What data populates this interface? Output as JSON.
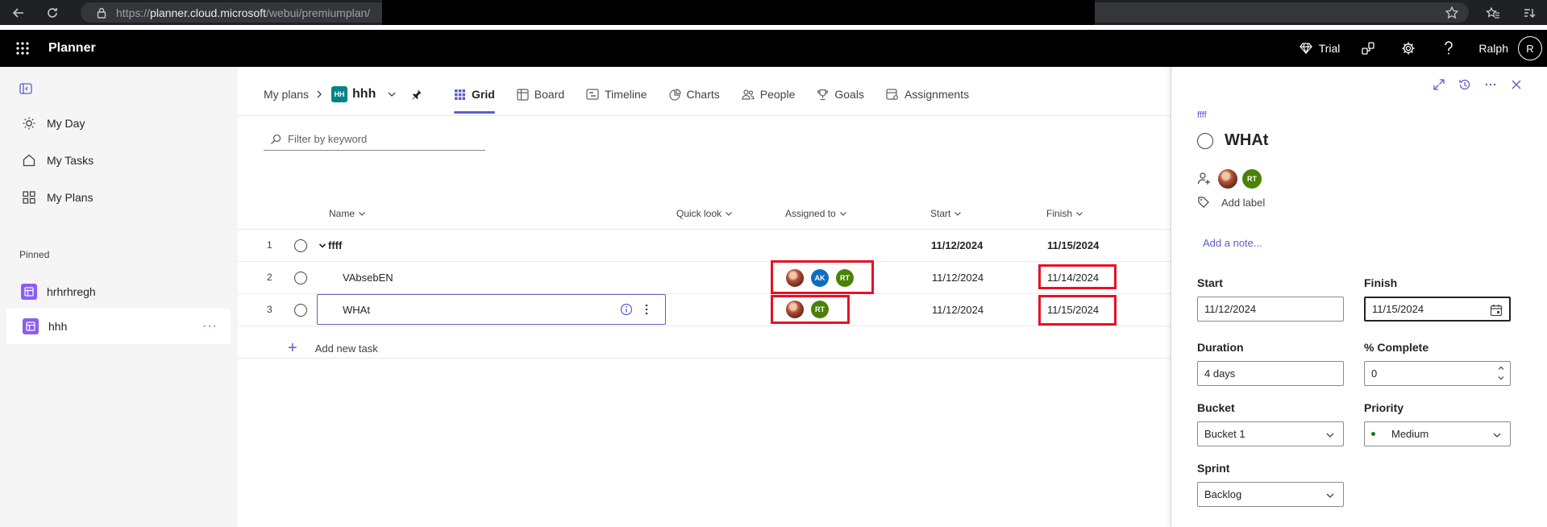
{
  "browser": {
    "url_prefix": "https://",
    "url_host": "planner.cloud.microsoft",
    "url_path": "/webui/premiumplan/"
  },
  "app": {
    "name": "Planner",
    "trial_label": "Trial",
    "user_name": "Ralph",
    "user_initial": "R"
  },
  "sidebar": {
    "items": [
      {
        "label": "My Day",
        "icon": "sun-icon"
      },
      {
        "label": "My Tasks",
        "icon": "home-icon"
      },
      {
        "label": "My Plans",
        "icon": "grid-icon"
      }
    ],
    "pinned_header": "Pinned",
    "pinned": [
      {
        "label": "hrhrhregh"
      },
      {
        "label": "hhh",
        "more": "···"
      }
    ]
  },
  "breadcrumb": {
    "root": "My plans",
    "plan_badge": "HH",
    "plan_name": "hhh"
  },
  "tabs": [
    {
      "label": "Grid",
      "icon": "grid-icon"
    },
    {
      "label": "Board",
      "icon": "board-icon"
    },
    {
      "label": "Timeline",
      "icon": "timeline-icon"
    },
    {
      "label": "Charts",
      "icon": "chart-icon"
    },
    {
      "label": "People",
      "icon": "people-icon"
    },
    {
      "label": "Goals",
      "icon": "trophy-icon"
    },
    {
      "label": "Assignments",
      "icon": "assignments-icon"
    }
  ],
  "filter": {
    "placeholder": "Filter by keyword"
  },
  "grid": {
    "columns": {
      "name": "Name",
      "quick_look": "Quick look",
      "assigned_to": "Assigned to",
      "start": "Start",
      "finish": "Finish"
    },
    "rows": [
      {
        "num": "1",
        "name": "ffff",
        "start": "11/12/2024",
        "finish": "11/15/2024"
      },
      {
        "num": "2",
        "name": "VAbsebEN",
        "start": "11/12/2024",
        "finish": "11/14/2024",
        "assignees": [
          "photo",
          "AK",
          "RT"
        ]
      },
      {
        "num": "3",
        "name": "WHAt",
        "start": "11/12/2024",
        "finish": "11/15/2024",
        "assignees": [
          "photo",
          "RT"
        ]
      }
    ],
    "add_task": "Add new task"
  },
  "detail": {
    "bucket_crumb": "ffff",
    "title": "WHAt",
    "assignee_rt": "RT",
    "add_label": "Add label",
    "add_note": "Add a note...",
    "start_label": "Start",
    "start_value": "11/12/2024",
    "finish_label": "Finish",
    "finish_value": "11/15/2024",
    "duration_label": "Duration",
    "duration_value": "4 days",
    "complete_label": "% Complete",
    "complete_value": "0",
    "bucket_label": "Bucket",
    "bucket_value": "Bucket 1",
    "priority_label": "Priority",
    "priority_value": "Medium",
    "sprint_label": "Sprint",
    "sprint_value": "Backlog"
  },
  "colors": {
    "accent": "#5b5fc7",
    "highlight": "#e81123",
    "plan_badge": "#038387",
    "plan_icon": "#8b5cf6",
    "avatar_ak": "#0f6cbd",
    "avatar_rt": "#498205"
  }
}
